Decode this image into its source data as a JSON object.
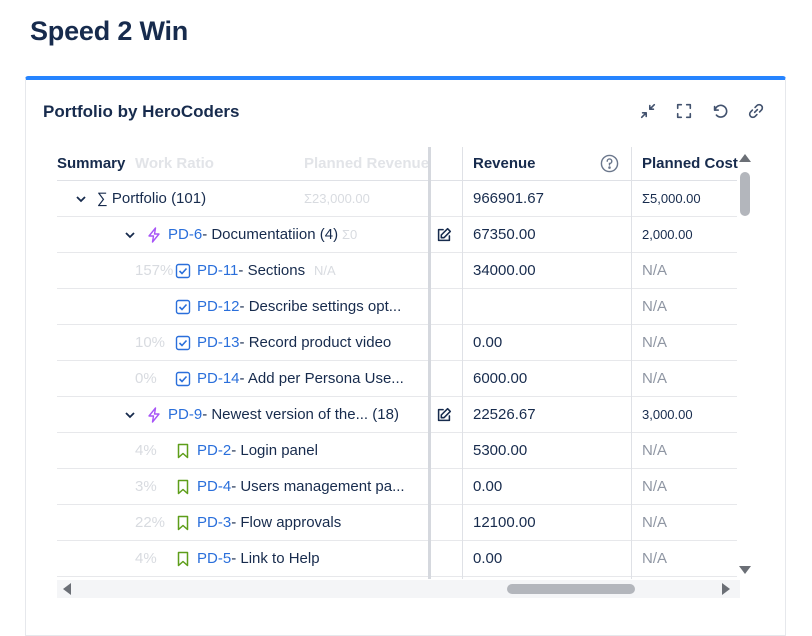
{
  "page": {
    "title": "Speed 2 Win"
  },
  "gadget": {
    "title": "Portfolio by HeroCoders",
    "tools": [
      "collapse-icon",
      "fullscreen-icon",
      "refresh-icon",
      "link-icon"
    ],
    "accent": "#2684ff"
  },
  "grid": {
    "headers": {
      "summary": "Summary",
      "work_ratio": "Work Ratio",
      "planned_revenue": "Planned Revenue",
      "revenue": "Revenue",
      "planned_cost": "Planned Cost"
    },
    "rows": [
      {
        "summary_key": "",
        "summary_text": "∑ Portfolio",
        "count": "(101)",
        "work_ratio": "",
        "planned_revenue": "Σ23,000.00",
        "revenue": "966901.67",
        "planned_cost": "Σ5,000.00"
      },
      {
        "summary_key": "PD-6",
        "summary_text": " - Documentatiion",
        "count": "(4)",
        "work_ratio": "",
        "planned_revenue": "Σ0",
        "revenue": "67350.00",
        "planned_cost": "2,000.00"
      },
      {
        "summary_key": "PD-11",
        "summary_text": " - Sections",
        "count": "",
        "work_ratio": "157%",
        "planned_revenue": "N/A",
        "revenue": "34000.00",
        "planned_cost": "N/A"
      },
      {
        "summary_key": "PD-12",
        "summary_text": " - Describe settings opt...",
        "count": "",
        "work_ratio": "",
        "planned_revenue": "",
        "revenue": "",
        "planned_cost": "N/A"
      },
      {
        "summary_key": "PD-13",
        "summary_text": " - Record product video",
        "count": "",
        "work_ratio": "10%",
        "planned_revenue": "",
        "revenue": "0.00",
        "planned_cost": "N/A"
      },
      {
        "summary_key": "PD-14",
        "summary_text": " - Add per Persona Use...",
        "count": "",
        "work_ratio": "0%",
        "planned_revenue": "",
        "revenue": "6000.00",
        "planned_cost": "N/A"
      },
      {
        "summary_key": "PD-9",
        "summary_text": " - Newest version of the...",
        "count": "(18)",
        "work_ratio": "",
        "planned_revenue": "",
        "revenue": "22526.67",
        "planned_cost": "3,000.00"
      },
      {
        "summary_key": "PD-2",
        "summary_text": " - Login panel",
        "count": "",
        "work_ratio": "4%",
        "planned_revenue": "",
        "revenue": "5300.00",
        "planned_cost": "N/A"
      },
      {
        "summary_key": "PD-4",
        "summary_text": " - Users management pa...",
        "count": "",
        "work_ratio": "3%",
        "planned_revenue": "",
        "revenue": "0.00",
        "planned_cost": "N/A"
      },
      {
        "summary_key": "PD-3",
        "summary_text": " - Flow approvals",
        "count": "",
        "work_ratio": "22%",
        "planned_revenue": "",
        "revenue": "12100.00",
        "planned_cost": "N/A"
      },
      {
        "summary_key": "PD-5",
        "summary_text": " - Link to Help",
        "count": "",
        "work_ratio": "4%",
        "planned_revenue": "",
        "revenue": "0.00",
        "planned_cost": "N/A"
      }
    ]
  }
}
